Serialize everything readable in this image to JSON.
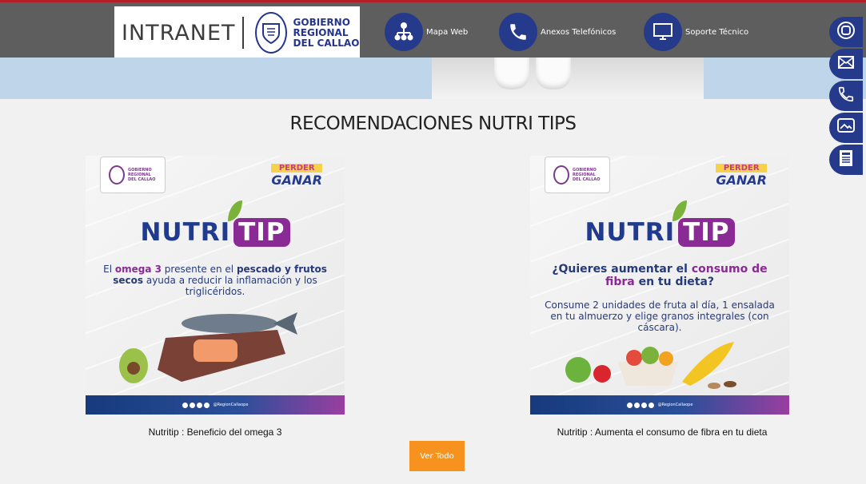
{
  "header": {
    "intranet_label": "INTRANET",
    "gov_name": [
      "GOBIERNO",
      "REGIONAL",
      "DEL CALLAO"
    ],
    "nav": [
      {
        "label": "Mapa Web",
        "icon": "sitemap-icon"
      },
      {
        "label": "Anexos Telefónicos",
        "icon": "phone-icon"
      },
      {
        "label": "Soporte Técnico",
        "icon": "monitor-icon"
      }
    ]
  },
  "side_bar": [
    {
      "icon": "instagram-icon"
    },
    {
      "icon": "mail-icon"
    },
    {
      "icon": "phone-icon"
    },
    {
      "icon": "gallery-icon"
    },
    {
      "icon": "news-icon"
    }
  ],
  "section": {
    "title": "RECOMENDACIONES NUTRI TIPS"
  },
  "cards": [
    {
      "badge": [
        "GOBIERNO",
        "REGIONAL",
        "DEL CALLAO"
      ],
      "campaign_top": "PERDER",
      "campaign_bottom": "GANAR",
      "headline_a": "NUTRI",
      "headline_b": "TIP",
      "body_parts": [
        "El ",
        "omega 3",
        " presente en el ",
        "pescado y frutos secos",
        " ayuda a reducir la inflamación y los triglicéridos."
      ],
      "footer_handle": "@RegionCallaope",
      "caption": "Nutritip : Beneficio del omega 3"
    },
    {
      "badge": [
        "GOBIERNO",
        "REGIONAL",
        "DEL CALLAO"
      ],
      "campaign_top": "PERDER",
      "campaign_bottom": "GANAR",
      "headline_a": "NUTRI",
      "headline_b": "TIP",
      "question_parts": [
        "¿Quieres aumentar el ",
        "consumo de fibra",
        " en tu dieta?"
      ],
      "body": "Consume 2 unidades de fruta al día, 1 ensalada en tu almuerzo y elige granos integrales (con cáscara).",
      "footer_handle": "@RegionCallaope",
      "caption": "Nutritip : Aumenta el consumo de fibra en tu dieta"
    }
  ],
  "button": {
    "label": "Ver Todo"
  },
  "colors": {
    "header": "#5e5e5e",
    "brand_blue": "#263a8c",
    "accent_orange": "#f7921e",
    "tip_purple": "#8a2a95"
  }
}
